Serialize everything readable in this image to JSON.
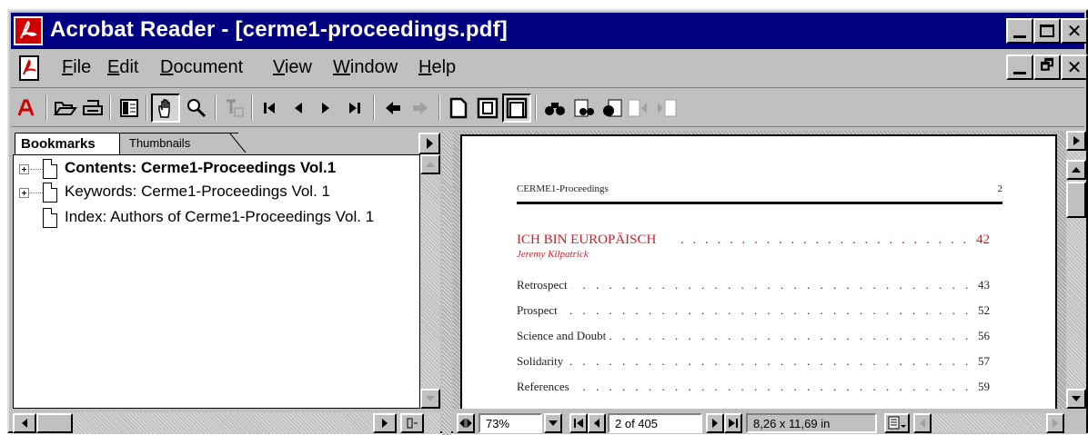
{
  "window": {
    "title": "Acrobat Reader - [cerme1-proceedings.pdf]"
  },
  "menu": {
    "items": [
      {
        "label": "File",
        "key": "F",
        "rest": "ile"
      },
      {
        "label": "Edit",
        "key": "E",
        "rest": "dit"
      },
      {
        "label": "Document",
        "key": "D",
        "rest": "ocument"
      },
      {
        "label": "View",
        "key": "V",
        "rest": "iew"
      },
      {
        "label": "Window",
        "key": "W",
        "rest": "indow"
      },
      {
        "label": "Help",
        "key": "H",
        "rest": "elp"
      }
    ]
  },
  "toolbar": {
    "icons": [
      "acrobat-logo-icon",
      "open-icon",
      "print-icon",
      "show-navigation-pane-icon",
      "hand-tool-icon",
      "zoom-tool-icon",
      "text-select-tool-icon",
      "first-page-icon",
      "previous-page-icon",
      "next-page-icon",
      "last-page-icon",
      "go-back-icon",
      "go-forward-icon",
      "actual-size-icon",
      "fit-page-icon",
      "fit-width-icon",
      "find-icon",
      "search-icon",
      "search-results-icon",
      "previous-highlight-icon",
      "next-highlight-icon"
    ]
  },
  "tabs": {
    "bookmarks": "Bookmarks",
    "thumbnails": "Thumbnails"
  },
  "bookmarks": [
    {
      "label": "Contents: Cerme1-Proceedings Vol.1",
      "bold": true,
      "expandable": true
    },
    {
      "label": "Keywords: Cerme1-Proceedings Vol. 1",
      "bold": false,
      "expandable": true
    },
    {
      "label": "Index: Authors of Cerme1-Proceedings Vol. 1",
      "bold": false,
      "expandable": false
    }
  ],
  "page": {
    "running_head": "CERME1-Proceedings",
    "page_number": "2",
    "main_entry": {
      "title": "ICH BIN EUROPÄISCH",
      "page": "42",
      "author": "Jeremy Kilpatrick"
    },
    "entries": [
      {
        "title": "Retrospect",
        "page": "43"
      },
      {
        "title": "Prospect",
        "page": "52"
      },
      {
        "title": "Science and Doubt",
        "page": "56"
      },
      {
        "title": "Solidarity",
        "page": "57"
      },
      {
        "title": "References",
        "page": "59"
      }
    ]
  },
  "status": {
    "zoom": "73%",
    "page_indicator": "2 of 405",
    "page_size": "8,26 x 11,69 in"
  },
  "colors": {
    "title_bar": "#000080",
    "toc_accent": "#c81f2c",
    "chrome": "#c0c0c0"
  }
}
